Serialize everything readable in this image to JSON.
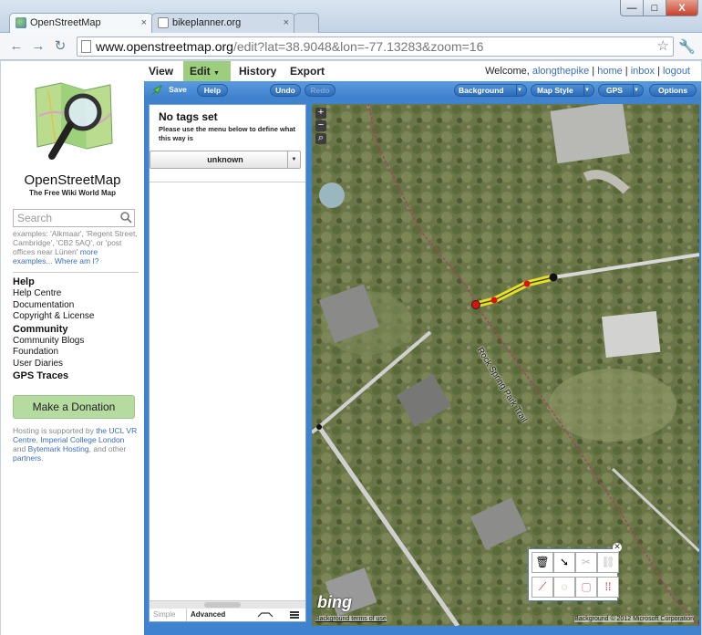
{
  "browser": {
    "tabs": [
      {
        "title": "OpenStreetMap",
        "active": true
      },
      {
        "title": "bikeplanner.org",
        "active": false
      }
    ],
    "url_host": "www.openstreetmap.org",
    "url_path": "/edit?lat=38.9048&lon=-77.13283&zoom=16",
    "close_glyph": "×",
    "window_buttons": {
      "minimize": "—",
      "maximize": "□",
      "close": "X"
    }
  },
  "sidebar": {
    "site_title": "OpenStreetMap",
    "site_subtitle": "The Free Wiki World Map",
    "search_placeholder": "Search",
    "search_hint_1": "examples: 'Alkmaar', 'Regent Street, Cambridge', 'CB2 5AQ', or 'post offices near Lünen'",
    "search_hint_more": "more examples...",
    "search_hint_where": "Where am I?",
    "help_heading": "Help",
    "help_items": [
      "Help Centre",
      "Documentation",
      "Copyright & License"
    ],
    "community_heading": "Community",
    "community_items": [
      "Community Blogs",
      "Foundation",
      "User Diaries"
    ],
    "gps_heading": "GPS Traces",
    "donate_label": "Make a Donation",
    "hosting_prefix": "Hosting is supported by",
    "hosting_link_1": "the UCL VR Centre",
    "hosting_sep_1": ",",
    "hosting_link_2": "Imperial College London",
    "hosting_and": "and",
    "hosting_link_3": "Bytemark Hosting",
    "hosting_other": ", and other",
    "hosting_link_4": "partners",
    "hosting_end": "."
  },
  "topnav": {
    "view": "View",
    "edit": "Edit",
    "history": "History",
    "export": "Export",
    "welcome": "Welcome,",
    "username": "alongthepike",
    "home": "home",
    "inbox": "inbox",
    "logout": "logout"
  },
  "editor": {
    "save": "Save",
    "help": "Help",
    "undo": "Undo",
    "redo": "Redo",
    "background": "Background",
    "map_style": "Map Style",
    "gps": "GPS",
    "options": "Options"
  },
  "tag_panel": {
    "title": "No tags set",
    "desc_line1": "Please use the menu below to define what",
    "desc_line2": "this way is",
    "select_value": "unknown",
    "tab_simple": "Simple",
    "tab_advanced": "Advanced"
  },
  "map": {
    "trail_label": "Rock Spring Park Trail",
    "bing_logo": "bing",
    "terms": "Background terms of use",
    "copyright": "Background © 2012 Microsoft Corporation",
    "zoom_in": "+",
    "zoom_out": "−"
  },
  "colors": {
    "edit_accent": "#9cce7d",
    "editor_blue": "#3f83cf",
    "selected_way": "#e6e020",
    "boundary_line": "#d63a3a"
  }
}
